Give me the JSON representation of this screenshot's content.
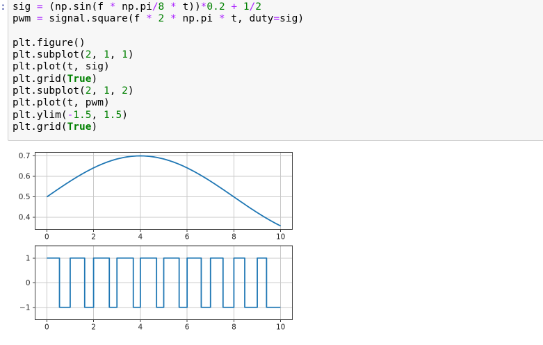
{
  "notebook": {
    "input_prompt": ":",
    "code_lines": [
      [
        {
          "t": "sig ",
          "c": "p"
        },
        {
          "t": "=",
          "c": "o"
        },
        {
          "t": " (np.sin(f ",
          "c": "p"
        },
        {
          "t": "*",
          "c": "o"
        },
        {
          "t": " np.pi",
          "c": "p"
        },
        {
          "t": "/",
          "c": "o"
        },
        {
          "t": "8",
          "c": "n"
        },
        {
          "t": " ",
          "c": "p"
        },
        {
          "t": "*",
          "c": "o"
        },
        {
          "t": " t))",
          "c": "p"
        },
        {
          "t": "*",
          "c": "o"
        },
        {
          "t": "0.2",
          "c": "n"
        },
        {
          "t": " ",
          "c": "p"
        },
        {
          "t": "+",
          "c": "o"
        },
        {
          "t": " ",
          "c": "p"
        },
        {
          "t": "1",
          "c": "n"
        },
        {
          "t": "/",
          "c": "o"
        },
        {
          "t": "2",
          "c": "n"
        }
      ],
      [
        {
          "t": "pwm ",
          "c": "p"
        },
        {
          "t": "=",
          "c": "o"
        },
        {
          "t": " signal.square(f ",
          "c": "p"
        },
        {
          "t": "*",
          "c": "o"
        },
        {
          "t": " ",
          "c": "p"
        },
        {
          "t": "2",
          "c": "n"
        },
        {
          "t": " ",
          "c": "p"
        },
        {
          "t": "*",
          "c": "o"
        },
        {
          "t": " np.pi ",
          "c": "p"
        },
        {
          "t": "*",
          "c": "o"
        },
        {
          "t": " t, duty",
          "c": "p"
        },
        {
          "t": "=",
          "c": "o"
        },
        {
          "t": "sig)",
          "c": "p"
        }
      ],
      [],
      [
        {
          "t": "plt.figure()",
          "c": "p"
        }
      ],
      [
        {
          "t": "plt.subplot(",
          "c": "p"
        },
        {
          "t": "2",
          "c": "n"
        },
        {
          "t": ", ",
          "c": "p"
        },
        {
          "t": "1",
          "c": "n"
        },
        {
          "t": ", ",
          "c": "p"
        },
        {
          "t": "1",
          "c": "n"
        },
        {
          "t": ")",
          "c": "p"
        }
      ],
      [
        {
          "t": "plt.plot(t, sig)",
          "c": "p"
        }
      ],
      [
        {
          "t": "plt.grid(",
          "c": "p"
        },
        {
          "t": "True",
          "c": "k"
        },
        {
          "t": ")",
          "c": "p"
        }
      ],
      [
        {
          "t": "plt.subplot(",
          "c": "p"
        },
        {
          "t": "2",
          "c": "n"
        },
        {
          "t": ", ",
          "c": "p"
        },
        {
          "t": "1",
          "c": "n"
        },
        {
          "t": ", ",
          "c": "p"
        },
        {
          "t": "2",
          "c": "n"
        },
        {
          "t": ")",
          "c": "p"
        }
      ],
      [
        {
          "t": "plt.plot(t, pwm)",
          "c": "p"
        }
      ],
      [
        {
          "t": "plt.ylim(",
          "c": "p"
        },
        {
          "t": "-",
          "c": "o"
        },
        {
          "t": "1.5",
          "c": "n"
        },
        {
          "t": ", ",
          "c": "p"
        },
        {
          "t": "1.5",
          "c": "n"
        },
        {
          "t": ")",
          "c": "p"
        }
      ],
      [
        {
          "t": "plt.grid(",
          "c": "p"
        },
        {
          "t": "True",
          "c": "k"
        },
        {
          "t": ")",
          "c": "p"
        }
      ]
    ]
  },
  "colors": {
    "page_bg": "#ffffff",
    "cell_bg": "#f7f7f7",
    "cell_border": "#cfcfcf",
    "prompt": "#303f9f",
    "code_default": "#000000",
    "operator": "#aa22ff",
    "number": "#008000",
    "keyword": "#008000",
    "line_blue": "#1f77b4",
    "grid": "#c9c9c9",
    "spine": "#3e3e3e",
    "tick_label": "#262626"
  },
  "chart_data": [
    {
      "type": "line",
      "title": "",
      "xlabel": "",
      "ylabel": "",
      "grid": true,
      "legend": null,
      "xlim": [
        -0.5,
        10.5
      ],
      "ylim": [
        0.3415,
        0.7171
      ],
      "xticks": [
        0,
        2,
        4,
        6,
        8,
        10
      ],
      "xtick_labels": [
        "0",
        "2",
        "4",
        "6",
        "8",
        "10"
      ],
      "yticks": [
        0.4,
        0.5,
        0.6,
        0.7
      ],
      "ytick_labels": [
        "0.4",
        "0.5",
        "0.6",
        "0.7"
      ],
      "series": [
        {
          "name": "sig",
          "color": "#1f77b4",
          "x": [
            0,
            0.5,
            1,
            1.5,
            2,
            2.5,
            3,
            3.5,
            4,
            4.5,
            5,
            5.5,
            6,
            6.5,
            7,
            7.5,
            8,
            8.5,
            9,
            9.5,
            10
          ],
          "y": [
            0.5,
            0.539,
            0.5765,
            0.6111,
            0.6414,
            0.6663,
            0.6848,
            0.6962,
            0.7,
            0.6962,
            0.6848,
            0.6663,
            0.6414,
            0.6111,
            0.5765,
            0.539,
            0.5,
            0.461,
            0.4235,
            0.3889,
            0.3586
          ],
          "formula": {
            "kind": "sine",
            "offset": 0.5,
            "amp": 0.2,
            "omega": 0.39269908,
            "x_start": 0,
            "x_end": 10,
            "step": 0.05
          }
        }
      ]
    },
    {
      "type": "line",
      "title": "",
      "xlabel": "",
      "ylabel": "",
      "grid": true,
      "legend": null,
      "xlim": [
        -0.5,
        10.5
      ],
      "ylim": [
        -1.5,
        1.5
      ],
      "xticks": [
        0,
        2,
        4,
        6,
        8,
        10
      ],
      "xtick_labels": [
        "0",
        "2",
        "4",
        "6",
        "8",
        "10"
      ],
      "yticks": [
        -1,
        0,
        1
      ],
      "ytick_labels": [
        "−1",
        "0",
        "1"
      ],
      "series": [
        {
          "name": "pwm",
          "color": "#1f77b4",
          "points": [
            [
              0,
              1
            ],
            [
              0.542,
              1
            ],
            [
              0.542,
              -1
            ],
            [
              1,
              -1
            ],
            [
              1,
              1
            ],
            [
              1.619,
              1
            ],
            [
              1.619,
              -1
            ],
            [
              2,
              -1
            ],
            [
              2,
              1
            ],
            [
              2.673,
              1
            ],
            [
              2.673,
              -1
            ],
            [
              3,
              -1
            ],
            [
              3,
              1
            ],
            [
              3.699,
              1
            ],
            [
              3.699,
              -1
            ],
            [
              4,
              -1
            ],
            [
              4,
              1
            ],
            [
              4.693,
              1
            ],
            [
              4.693,
              -1
            ],
            [
              5,
              -1
            ],
            [
              5,
              1
            ],
            [
              5.659,
              1
            ],
            [
              5.659,
              -1
            ],
            [
              6,
              -1
            ],
            [
              6,
              1
            ],
            [
              6.604,
              1
            ],
            [
              6.604,
              -1
            ],
            [
              7,
              -1
            ],
            [
              7,
              1
            ],
            [
              7.536,
              1
            ],
            [
              7.536,
              -1
            ],
            [
              8,
              -1
            ],
            [
              8,
              1
            ],
            [
              8.464,
              1
            ],
            [
              8.464,
              -1
            ],
            [
              9,
              -1
            ],
            [
              9,
              1
            ],
            [
              9.396,
              1
            ],
            [
              9.396,
              -1
            ],
            [
              9.99,
              -1
            ]
          ]
        }
      ]
    }
  ]
}
